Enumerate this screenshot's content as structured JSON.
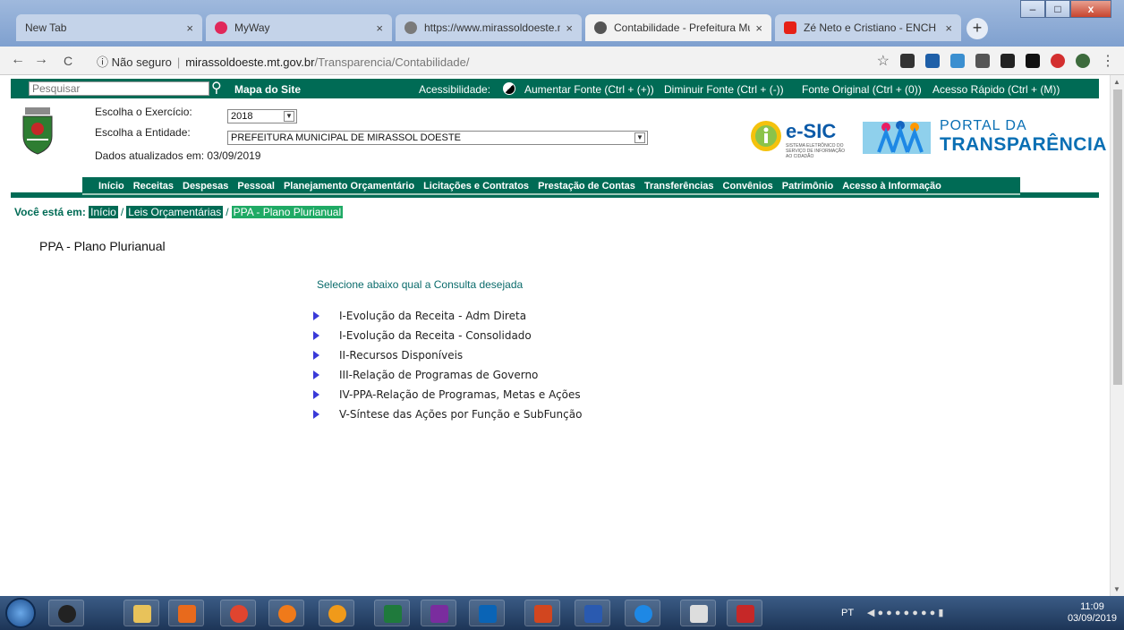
{
  "browser": {
    "tabs": [
      {
        "label": "New Tab",
        "color": "#ffffff"
      },
      {
        "label": "MyWay",
        "color": "#e0285a"
      },
      {
        "label": "https://www.mirassoldoeste.mt",
        "color": "#7a7a7a"
      },
      {
        "label": "Contabilidade - Prefeitura Muni",
        "color": "#555555"
      },
      {
        "label": "Zé Neto e Cristiano - ENCH",
        "color": "#e62117"
      }
    ],
    "tab_close": "×",
    "new_tab": "+",
    "window_controls": {
      "minimize": "–",
      "maximize": "□",
      "close": "x"
    },
    "nav": {
      "back": "←",
      "forward": "→",
      "reload": "C"
    },
    "address": {
      "security_label": "ⓘ Não seguro",
      "host": "mirassoldoeste.mt.gov.br",
      "path": "/Transparencia/Contabilidade/"
    },
    "bookmark_star": "☆",
    "menu_dots": "⋮"
  },
  "site": {
    "topbar": {
      "search_placeholder": "Pesquisar",
      "sitemap": "Mapa do Site",
      "accessibility_label": "Acessibilidade:",
      "increase_font": "Aumentar Fonte (Ctrl + (+))",
      "decrease_font": "Diminuir Fonte (Ctrl + (-))",
      "original_font": "Fonte Original (Ctrl + (0))",
      "quick_access": "Acesso Rápido (Ctrl + (M))"
    },
    "header": {
      "exercise_label": "Escolha o Exercício:",
      "exercise_value": "2018",
      "entity_label": "Escolha a Entidade:",
      "entity_value": "PREFEITURA MUNICIPAL DE MIRASSOL DOESTE",
      "updated": "Dados atualizados em: 03/09/2019",
      "esic": "e-SIC",
      "esic_sub": "SISTEMA ELETRÔNICO DO SERVIÇO DE INFORMAÇÃO AO CIDADÃO",
      "portal_line1": "PORTAL DA",
      "portal_line2": "TRANSPARÊNCIA"
    },
    "menu": [
      "Início",
      "Receitas",
      "Despesas",
      "Pessoal",
      "Planejamento Orçamentário",
      "Licitações e Contratos",
      "Prestação de Contas",
      "Transferências",
      "Convênios",
      "Patrimônio",
      "Acesso à Informação"
    ],
    "breadcrumb": {
      "label": "Você está em:",
      "items": [
        "Início",
        "Leis Orçamentárias",
        "PPA - Plano Plurianual"
      ],
      "sep": "/"
    },
    "page_title": "PPA - Plano Plurianual",
    "lead": "Selecione abaixo qual a Consulta desejada",
    "options": [
      "I-Evolução da Receita - Adm Direta",
      "I-Evolução da Receita - Consolidado",
      "II-Recursos Disponíveis",
      "III-Relação de Programas de Governo",
      "IV-PPA-Relação de Programas, Metas e Ações",
      "V-Síntese das Ações por Função e SubFunção"
    ]
  },
  "taskbar": {
    "tray_lang": "PT",
    "time": "11:09",
    "date": "03/09/2019",
    "apps": [
      {
        "name": "media-icon",
        "color": "#222222"
      },
      {
        "name": "file-explorer-icon",
        "color": "#e8c25a"
      },
      {
        "name": "media-player-icon",
        "color": "#e86a1c"
      },
      {
        "name": "chrome-icon",
        "color": "#e0452f"
      },
      {
        "name": "firefox-icon",
        "color": "#f07a1a"
      },
      {
        "name": "firefox-alt-icon",
        "color": "#f09a1a"
      },
      {
        "name": "excel-icon",
        "color": "#1f7a3c"
      },
      {
        "name": "onenote-icon",
        "color": "#7a2d9e"
      },
      {
        "name": "outlook-icon",
        "color": "#0a64b6"
      },
      {
        "name": "powerpoint-icon",
        "color": "#d2461f"
      },
      {
        "name": "word-icon",
        "color": "#2a5ab0"
      },
      {
        "name": "internet-explorer-icon",
        "color": "#1e88e5"
      },
      {
        "name": "notepad-icon",
        "color": "#dddddd"
      },
      {
        "name": "app-icon",
        "color": "#c62828"
      }
    ]
  },
  "colors": {
    "site_green": "#006b55",
    "link_blue": "#0a6fb4"
  }
}
